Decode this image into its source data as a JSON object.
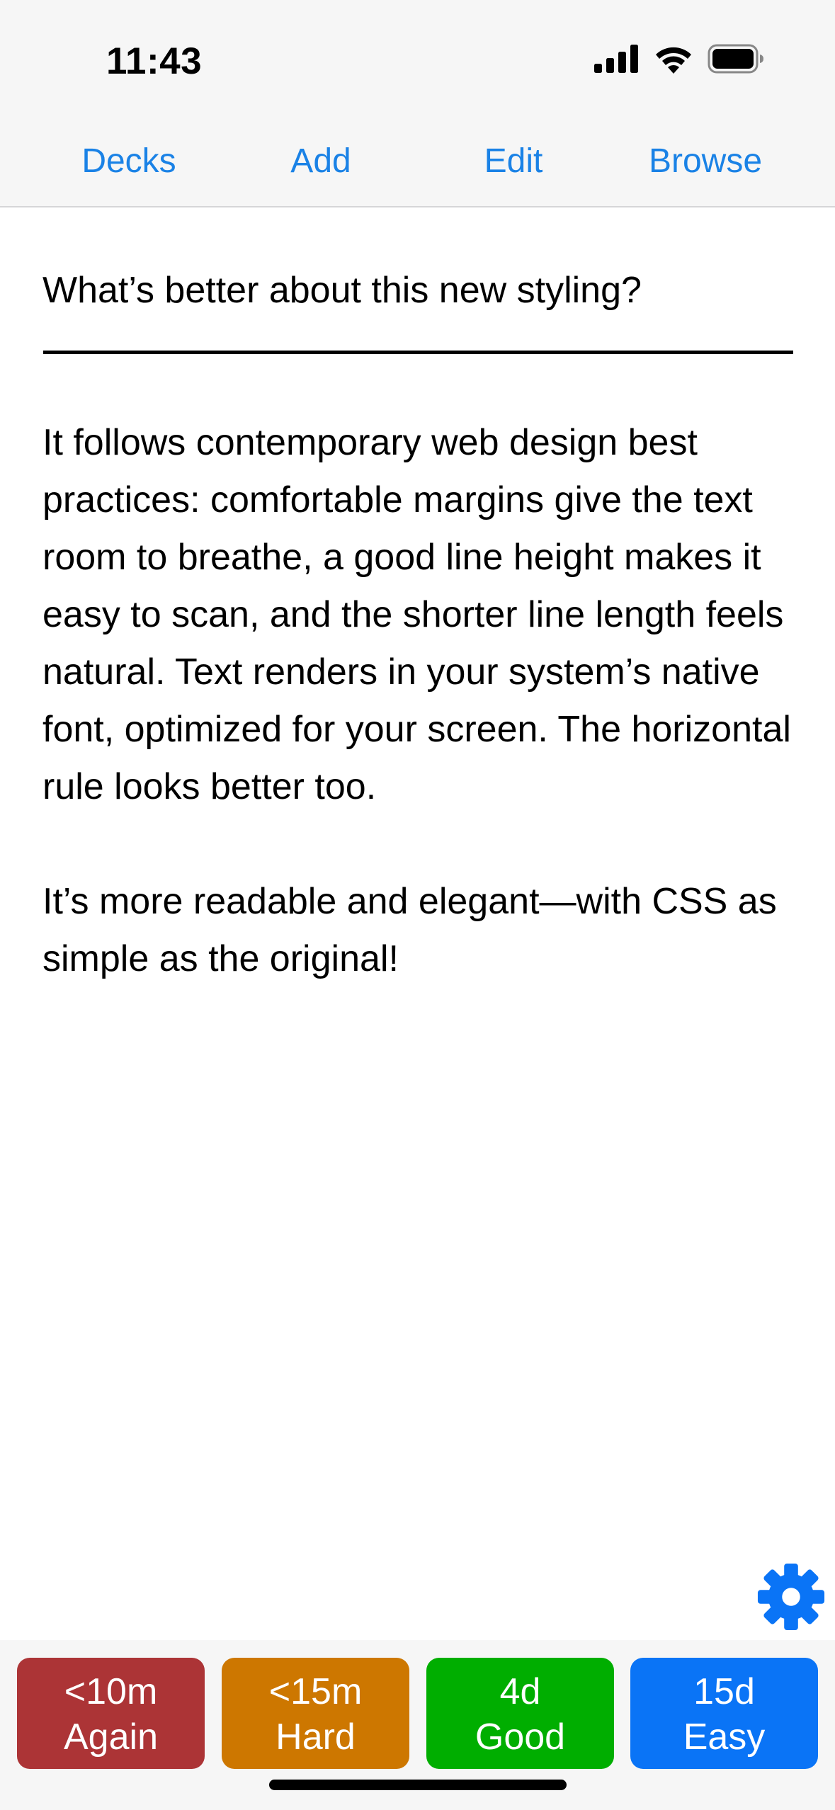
{
  "status_bar": {
    "time": "11:43",
    "icons": [
      "cellular-signal-icon",
      "wifi-icon",
      "battery-icon"
    ]
  },
  "nav": {
    "decks": "Decks",
    "add": "Add",
    "edit": "Edit",
    "browse": "Browse",
    "link_color": "#1a82e6"
  },
  "card": {
    "question": "What’s better about this new styling?",
    "answer_paragraphs": [
      "It follows contemporary web design best practices: comfortable margins give the text room to breathe, a good line height makes it easy to scan, and the shorter line length feels natural. Text renders in your system’s native font, optimized for your screen. The horizontal rule looks better too.",
      "It’s more readable and elegant—with CSS as simple as the original!"
    ]
  },
  "settings": {
    "icon": "gear-icon",
    "color": "#0a74f6"
  },
  "answer_buttons": [
    {
      "interval": "<10m",
      "label": "Again",
      "color": "#ac3436"
    },
    {
      "interval": "<15m",
      "label": "Hard",
      "color": "#cd7700"
    },
    {
      "interval": "4d",
      "label": "Good",
      "color": "#00ae00"
    },
    {
      "interval": "15d",
      "label": "Easy",
      "color": "#0a74f6"
    }
  ]
}
